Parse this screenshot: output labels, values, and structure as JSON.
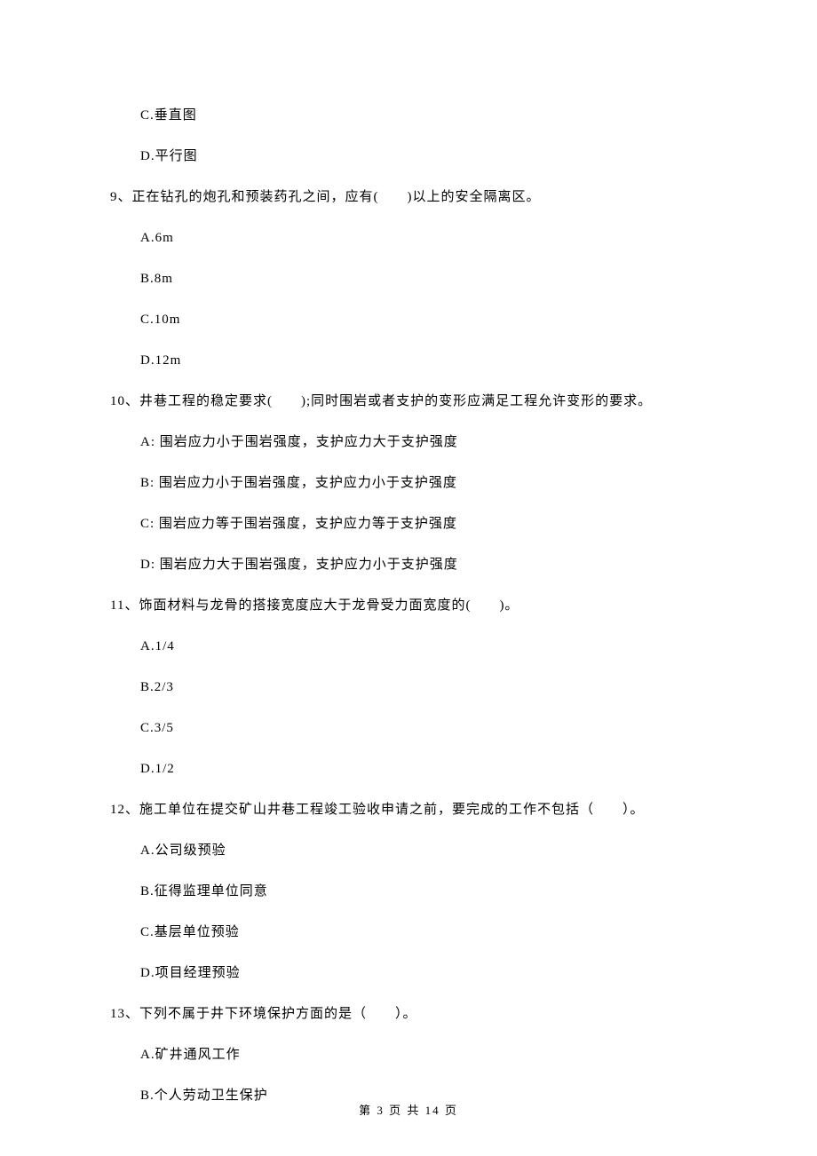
{
  "options_top": {
    "c": "C.垂直图",
    "d": "D.平行图"
  },
  "q9": {
    "stem": "9、正在钻孔的炮孔和预装药孔之间，应有(　　)以上的安全隔离区。",
    "a": "A.6m",
    "b": "B.8m",
    "c": "C.10m",
    "d": "D.12m"
  },
  "q10": {
    "stem": "10、井巷工程的稳定要求(　　);同时围岩或者支护的变形应满足工程允许变形的要求。",
    "a": "A: 围岩应力小于围岩强度，支护应力大于支护强度",
    "b": "B: 围岩应力小于围岩强度，支护应力小于支护强度",
    "c": "C: 围岩应力等于围岩强度，支护应力等于支护强度",
    "d": "D: 围岩应力大于围岩强度，支护应力小于支护强度"
  },
  "q11": {
    "stem": "11、饰面材料与龙骨的搭接宽度应大于龙骨受力面宽度的(　　)。",
    "a": "A.1/4",
    "b": "B.2/3",
    "c": "C.3/5",
    "d": "D.1/2"
  },
  "q12": {
    "stem": "12、施工单位在提交矿山井巷工程竣工验收申请之前，要完成的工作不包括（　　）。",
    "a": "A.公司级预验",
    "b": "B.征得监理单位同意",
    "c": "C.基层单位预验",
    "d": "D.项目经理预验"
  },
  "q13": {
    "stem": "13、下列不属于井下环境保护方面的是（　　）。",
    "a": "A.矿井通风工作",
    "b": "B.个人劳动卫生保护"
  },
  "footer": "第 3 页 共 14 页"
}
